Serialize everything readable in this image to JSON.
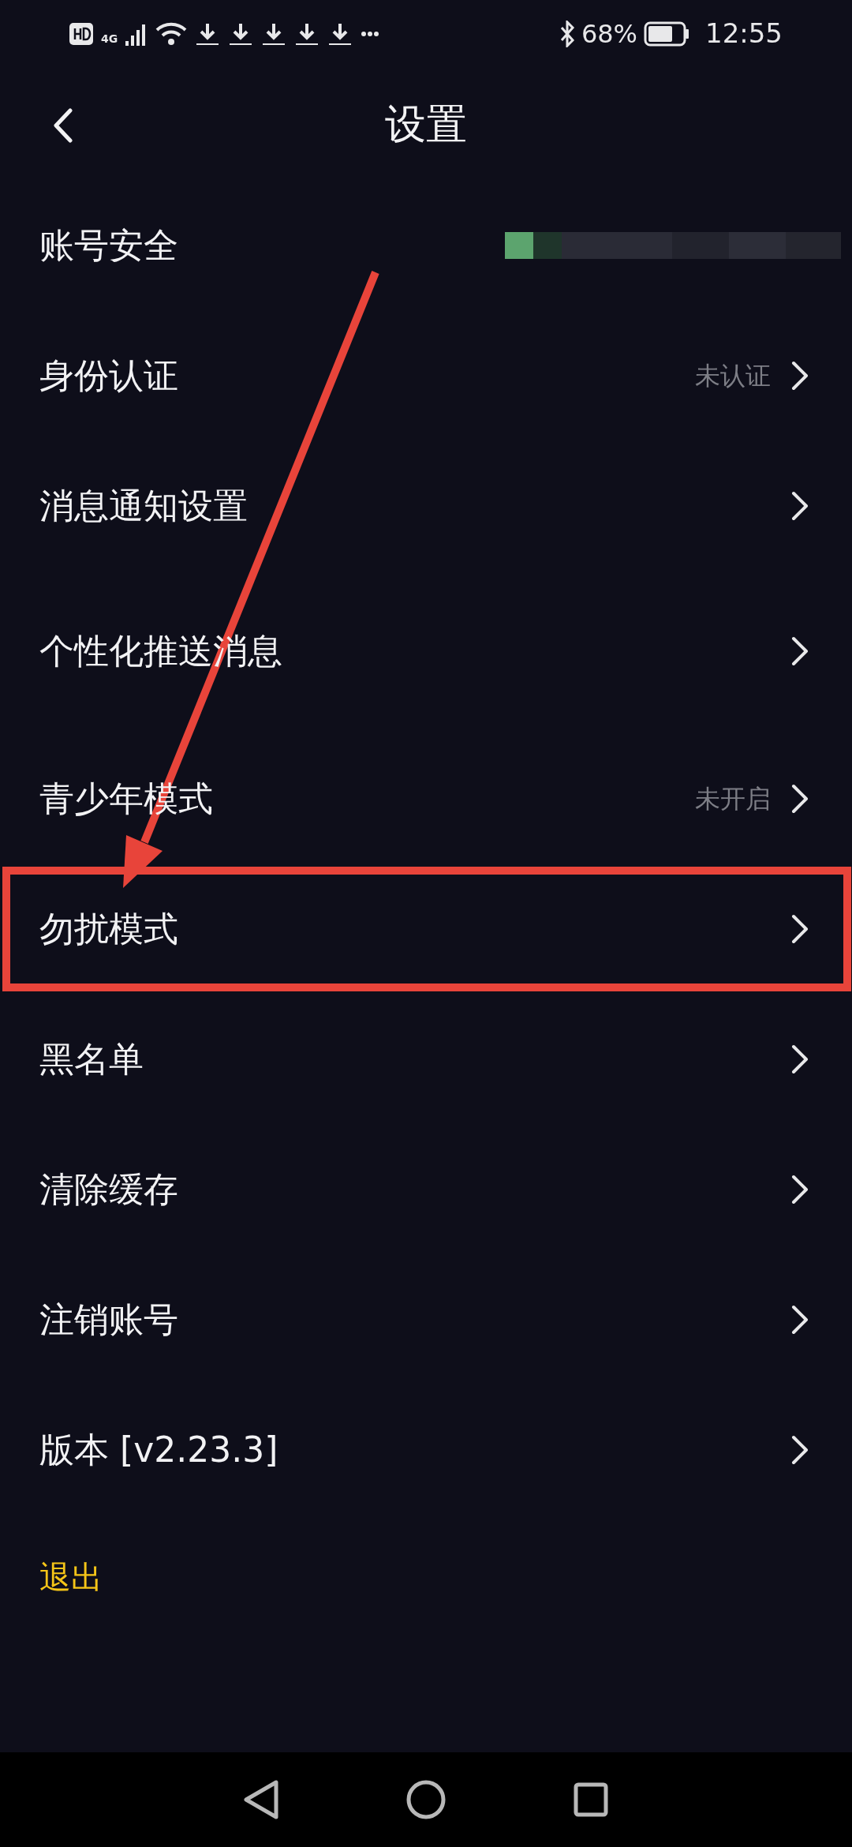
{
  "status_bar": {
    "network": "4G",
    "battery": "68%",
    "time": "12:55"
  },
  "header": {
    "title": "设置"
  },
  "rows": [
    {
      "label": "账号安全",
      "kind": "redacted"
    },
    {
      "label": "身份认证",
      "value": "未认证",
      "kind": "link"
    },
    {
      "label": "消息通知设置",
      "kind": "link"
    },
    {
      "label": "个性化推送消息",
      "kind": "link"
    },
    {
      "label": "青少年模式",
      "value": "未开启",
      "kind": "link"
    },
    {
      "label": "勿扰模式",
      "kind": "link"
    },
    {
      "label": "黑名单",
      "kind": "link"
    },
    {
      "label": "清除缓存",
      "kind": "link"
    },
    {
      "label": "注销账号",
      "kind": "link"
    },
    {
      "label": "版本 [v2.23.3]",
      "kind": "link"
    }
  ],
  "logout": "退出"
}
